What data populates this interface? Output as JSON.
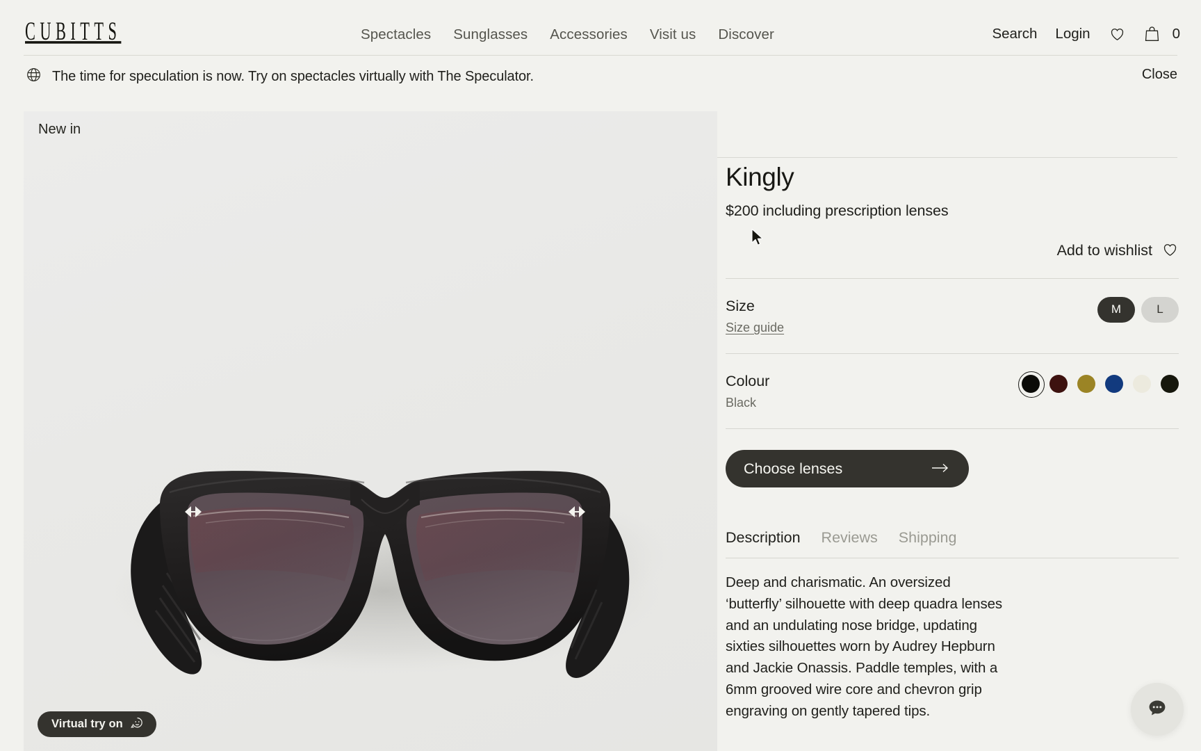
{
  "header": {
    "logo": "CUBITTS",
    "nav": [
      {
        "label": "Spectacles"
      },
      {
        "label": "Sunglasses"
      },
      {
        "label": "Accessories"
      },
      {
        "label": "Visit us"
      },
      {
        "label": "Discover"
      }
    ],
    "search_label": "Search",
    "login_label": "Login",
    "wishlist_icon": "heart-icon",
    "cart_icon": "shopping-bag-icon",
    "cart_count": "0"
  },
  "announcement": {
    "icon": "globe-icon",
    "text": "The time for speculation is now. Try on spectacles virtually with The Speculator.",
    "close_label": "Close"
  },
  "gallery": {
    "badge": "New in",
    "try_on_label": "Virtual try on",
    "try_on_icon": "face-scan-icon",
    "product_image_alt": "Kingly black oversized butterfly sunglasses"
  },
  "product": {
    "title": "Kingly",
    "price": "$200 including prescription lenses",
    "wishlist_label": "Add to wishlist",
    "wishlist_icon": "heart-icon",
    "size": {
      "label": "Size",
      "guide_label": "Size guide",
      "options": [
        {
          "label": "M",
          "selected": true
        },
        {
          "label": "L",
          "selected": false
        }
      ]
    },
    "colour": {
      "label": "Colour",
      "selected_name": "Black",
      "options": [
        {
          "name": "Black",
          "hex": "#0b0b08",
          "selected": true
        },
        {
          "name": "Dark Burgundy",
          "hex": "#3d120f",
          "selected": false
        },
        {
          "name": "Olive",
          "hex": "#9b8425",
          "selected": false
        },
        {
          "name": "Navy",
          "hex": "#123a7e",
          "selected": false
        },
        {
          "name": "Ivory",
          "hex": "#eceade",
          "selected": false
        },
        {
          "name": "Dark Olive",
          "hex": "#16170c",
          "selected": false
        }
      ]
    },
    "cta_label": "Choose lenses",
    "cta_icon": "arrow-right-icon",
    "tabs": [
      {
        "label": "Description",
        "active": true
      },
      {
        "label": "Reviews",
        "active": false
      },
      {
        "label": "Shipping",
        "active": false
      }
    ],
    "description": "Deep and charismatic. An oversized ‘butterfly’ silhouette with deep quadra lenses and an undulating nose bridge, updating sixties silhouettes worn by Audrey Hepburn and Jackie Onassis. Paddle temples, with a 6mm grooved wire core and chevron grip engraving on gently tapered tips."
  },
  "chat": {
    "icon": "chat-bubble-icon"
  },
  "theme": {
    "background": "#f2f2ee",
    "ink": "#1f1f1b",
    "muted": "#6a6a62",
    "dark_pill": "#34332e",
    "rule": "#d6d6d0"
  }
}
